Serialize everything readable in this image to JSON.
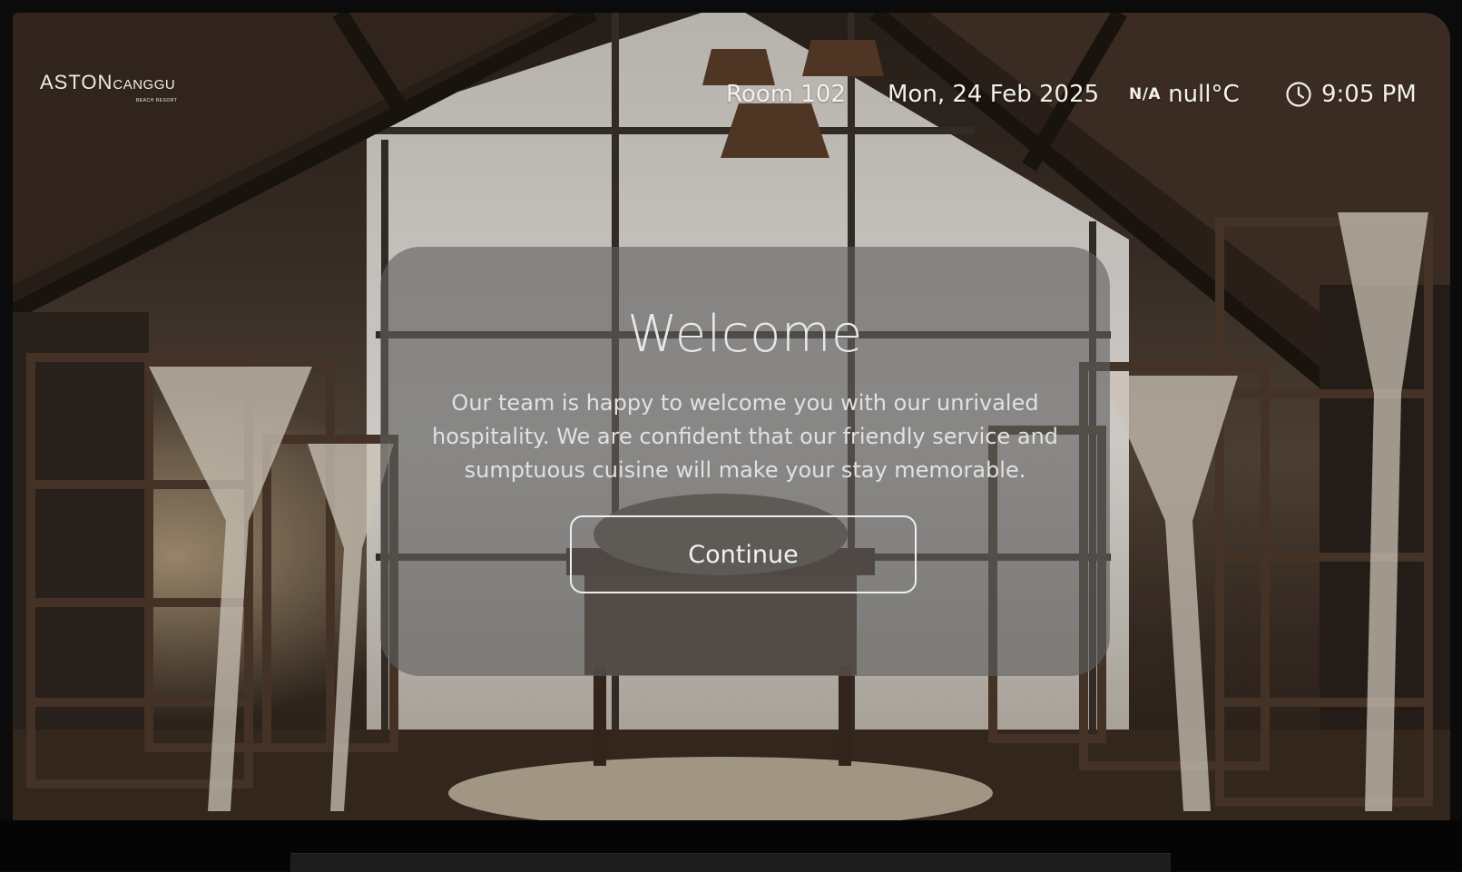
{
  "brand": {
    "logo_main": "ASTON",
    "logo_sub": "CANGGU",
    "logo_small": "BEACH RESORT"
  },
  "header": {
    "room": "Room 102",
    "date": "Mon, 24 Feb 2025",
    "weather_code": "N/A",
    "temperature": "null°C",
    "time": "9:05 PM",
    "clock_icon": "clock-icon"
  },
  "welcome": {
    "title": "Welcome",
    "body": "Our team is happy to welcome you with our unrivaled hospitality. We are confident that our friendly service and sumptuous cuisine will make your stay memorable.",
    "continue_label": "Continue"
  },
  "colors": {
    "panel_overlay": "#5f5f5f",
    "text": "#f4f0ea"
  }
}
